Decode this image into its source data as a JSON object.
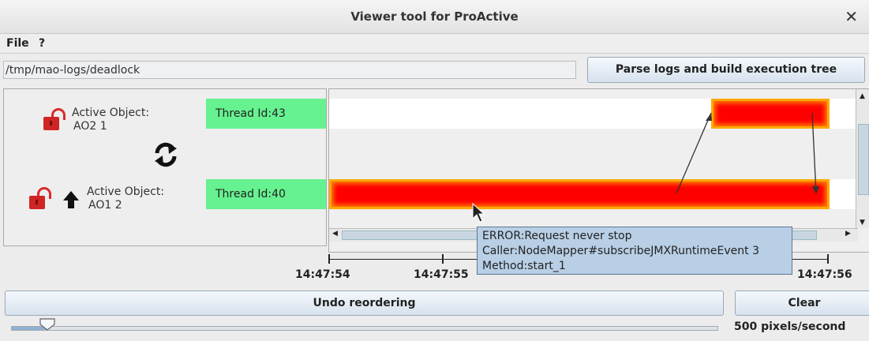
{
  "window": {
    "title": "Viewer tool for ProActive",
    "close_icon": "close-icon"
  },
  "menu": {
    "items": [
      "File",
      "?"
    ]
  },
  "path": {
    "value": "/tmp/mao-logs/deadlock"
  },
  "buttons": {
    "parse": "Parse logs and build execution tree",
    "undo": "Undo reordering",
    "clear": "Clear"
  },
  "active_objects": [
    {
      "label_line1": "Active Object:",
      "label_line2": "AO2 1",
      "thread": "Thread Id:43",
      "icons": [
        "unlocked-padlock-icon"
      ]
    },
    {
      "label_line1": "Active Object:",
      "label_line2": "AO1 2",
      "thread": "Thread Id:40",
      "icons": [
        "unlocked-padlock-icon",
        "up-arrow-icon"
      ]
    }
  ],
  "reorder_icon": "refresh-icon",
  "time_axis": {
    "labels": [
      "14:47:54",
      "14:47:55",
      "14:47:56"
    ]
  },
  "tooltip": {
    "line1": "ERROR:Request never stop",
    "line2": "Caller:NodeMapper#subscribeJMXRuntimeEvent 3",
    "line3": "Method:start_1"
  },
  "speed": {
    "label": "500 pixels/second",
    "slider_fraction": 0.05
  },
  "colors": {
    "thread_bg": "#66f290",
    "bar_fill": "#ff0000",
    "bar_border": "#ffa800",
    "tooltip_bg": "#b8cfe5"
  }
}
